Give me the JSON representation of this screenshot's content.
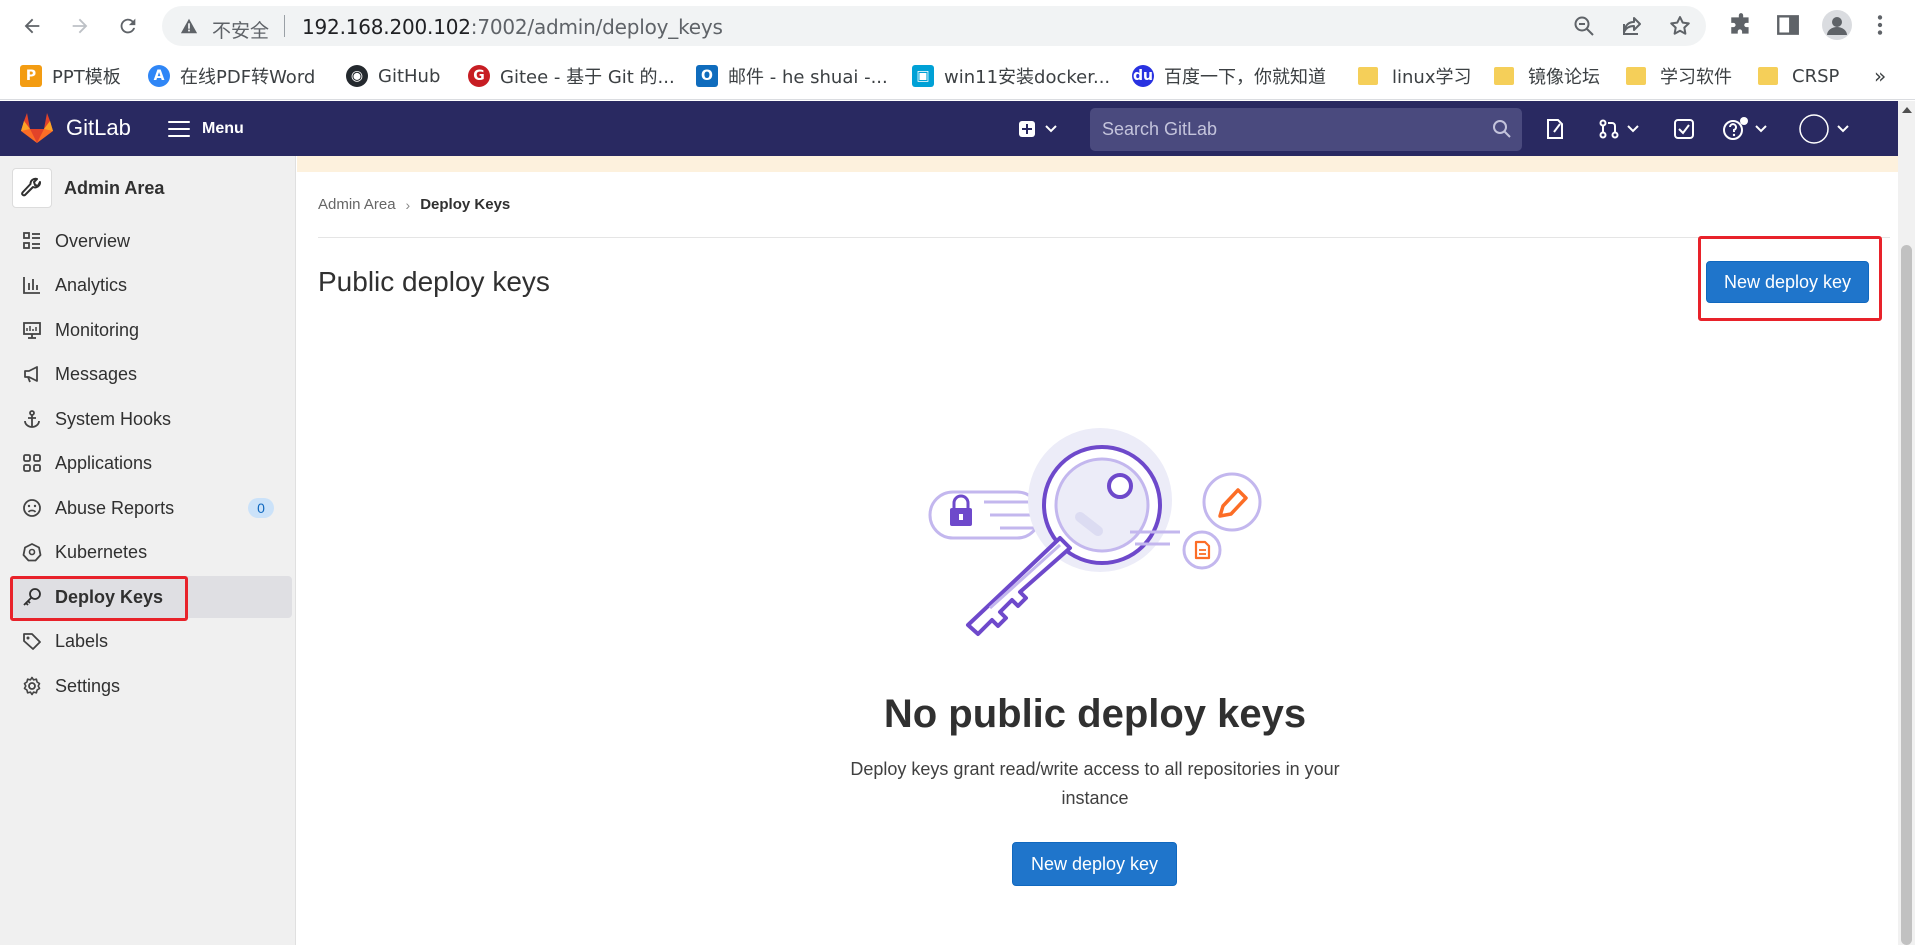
{
  "browser": {
    "insecure_label": "不安全",
    "url_host": "192.168.200.102",
    "url_rest": ":7002/admin/deploy_keys",
    "bookmarks": [
      {
        "label": "PPT模板",
        "icon": "ppt-icon",
        "color": "#f39c12"
      },
      {
        "label": "在线PDF转Word",
        "icon": "pdf-convert-icon",
        "color": "#2f86f6"
      },
      {
        "label": "GitHub",
        "icon": "github-icon",
        "color": "#24292e"
      },
      {
        "label": "Gitee - 基于 Git 的...",
        "icon": "gitee-icon",
        "color": "#c71d23"
      },
      {
        "label": "邮件 - he shuai -...",
        "icon": "outlook-icon",
        "color": "#0f6cbd"
      },
      {
        "label": "win11安装docker...",
        "icon": "bilibili-icon",
        "color": "#00a1d6"
      },
      {
        "label": "百度一下，你就知道",
        "icon": "baidu-icon",
        "color": "#2932e1"
      },
      {
        "label": "linux学习",
        "icon": "folder-icon"
      },
      {
        "label": "镜像论坛",
        "icon": "folder-icon"
      },
      {
        "label": "学习软件",
        "icon": "folder-icon"
      },
      {
        "label": "CRSP",
        "icon": "folder-icon"
      }
    ],
    "more_bookmarks": "»"
  },
  "gitlab": {
    "brand": "GitLab",
    "menu_label": "Menu",
    "search_placeholder": "Search GitLab",
    "header_color": "#292961"
  },
  "sidebar": {
    "title": "Admin Area",
    "items": [
      {
        "label": "Overview",
        "icon": "overview-icon"
      },
      {
        "label": "Analytics",
        "icon": "analytics-icon"
      },
      {
        "label": "Monitoring",
        "icon": "monitoring-icon"
      },
      {
        "label": "Messages",
        "icon": "messages-icon"
      },
      {
        "label": "System Hooks",
        "icon": "hook-icon"
      },
      {
        "label": "Applications",
        "icon": "applications-icon"
      },
      {
        "label": "Abuse Reports",
        "icon": "abuse-icon",
        "badge": "0"
      },
      {
        "label": "Kubernetes",
        "icon": "kubernetes-icon"
      },
      {
        "label": "Deploy Keys",
        "icon": "key-icon",
        "active": true
      },
      {
        "label": "Labels",
        "icon": "label-icon"
      },
      {
        "label": "Settings",
        "icon": "settings-icon"
      }
    ]
  },
  "main": {
    "breadcrumb": [
      "Admin Area",
      "Deploy Keys"
    ],
    "title": "Public deploy keys",
    "new_key_button": "New deploy key",
    "empty_title": "No public deploy keys",
    "empty_description": "Deploy keys grant read/write access to all repositories in your instance",
    "empty_button": "New deploy key",
    "accent_color": "#1f75cb",
    "highlight_color": "#e8222a"
  }
}
